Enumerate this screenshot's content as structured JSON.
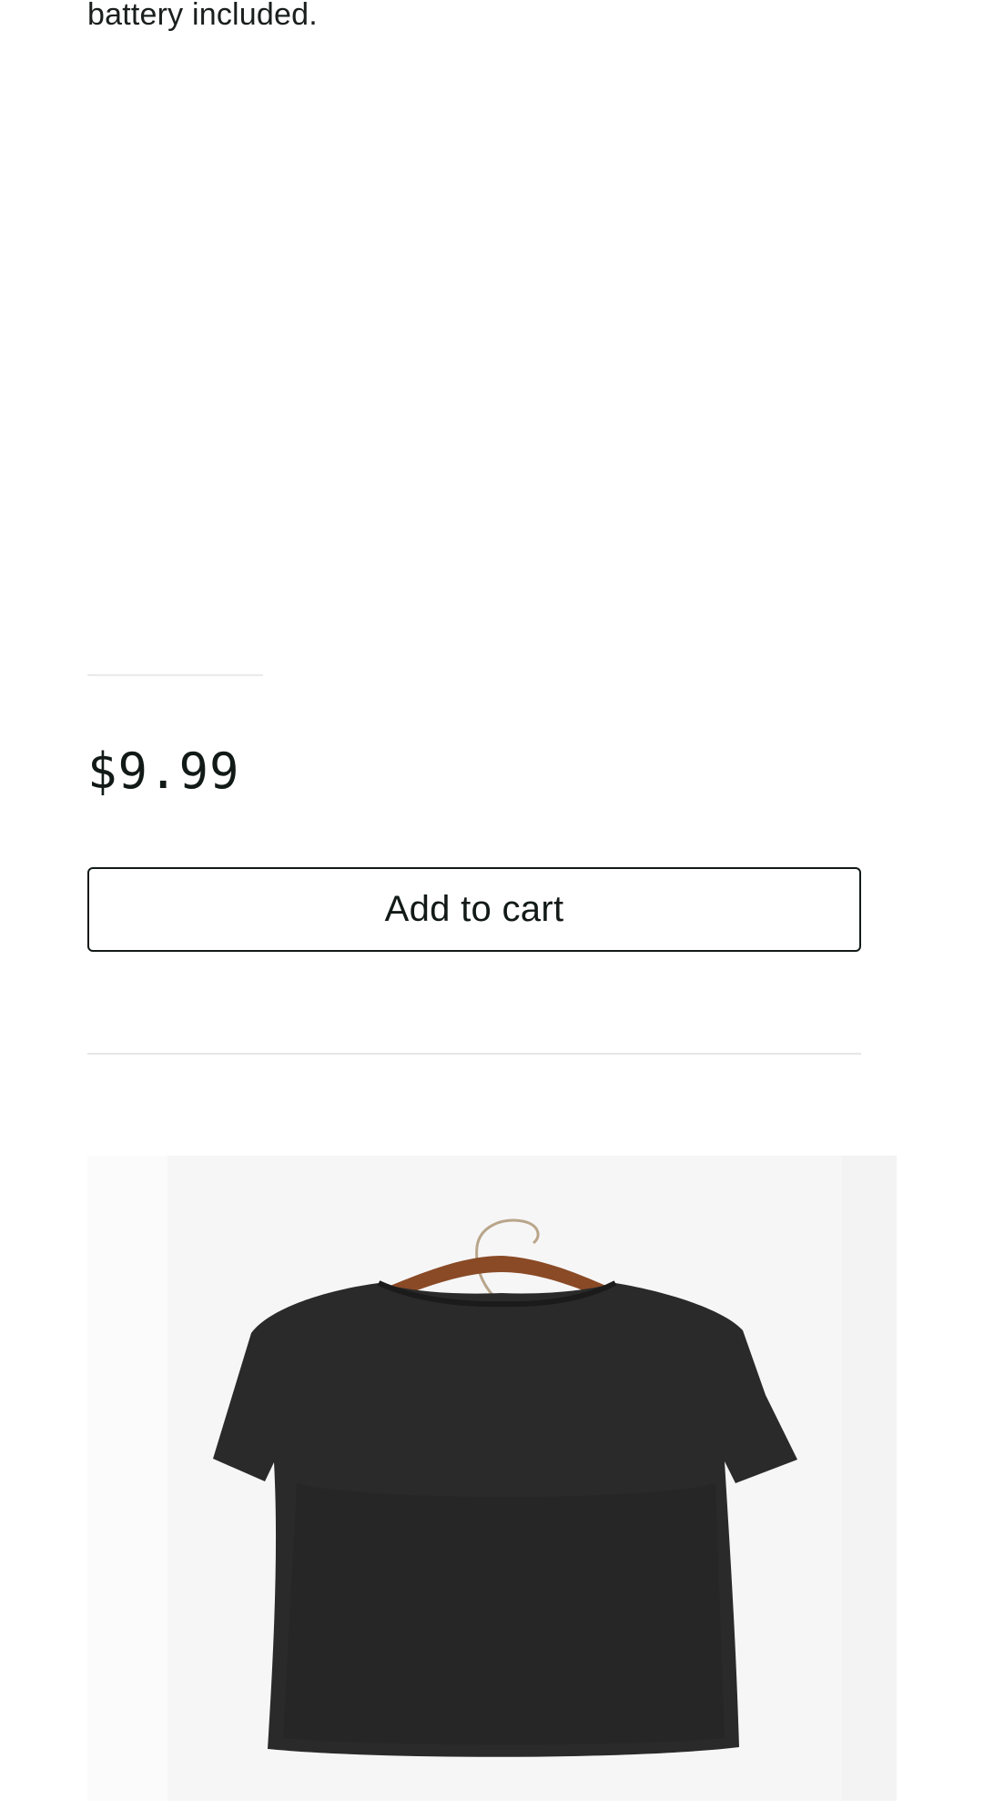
{
  "product": {
    "description_tail": "battery included.",
    "price": "$9.99",
    "add_to_cart_label": "Add to cart",
    "image_icon": "t-shirt-on-hanger-image"
  },
  "colors": {
    "text": "#121a18",
    "button_border": "#121a18",
    "divider": "#e6e6e6",
    "shirt": "#2a2a2a",
    "hanger": "#8a4a26"
  }
}
